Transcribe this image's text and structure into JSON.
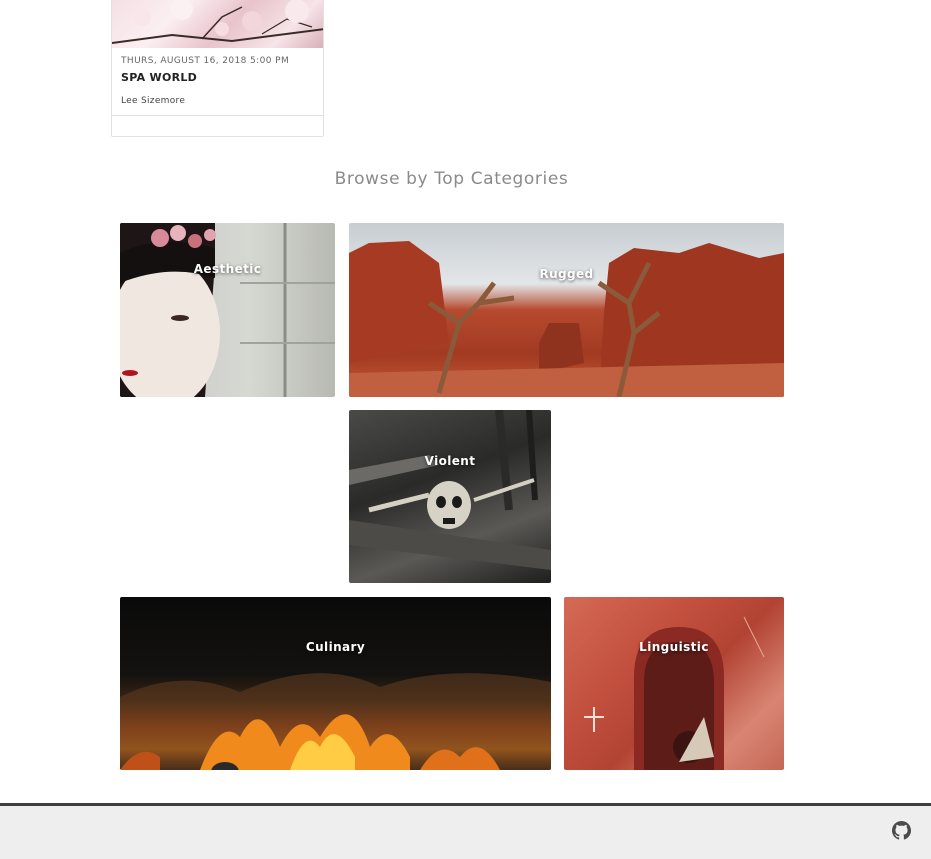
{
  "event_card": {
    "date": "THURS, AUGUST 16, 2018 5:00 PM",
    "title": "SPA WORLD",
    "organizer": "Lee Sizemore"
  },
  "categories_section": {
    "heading": "Browse by Top Categories",
    "tiles": [
      {
        "label": "Aesthetic"
      },
      {
        "label": "Rugged"
      },
      {
        "label": "Violent"
      },
      {
        "label": "Culinary"
      },
      {
        "label": "Linguistic"
      }
    ]
  },
  "footer": {
    "icon": "github-icon"
  }
}
